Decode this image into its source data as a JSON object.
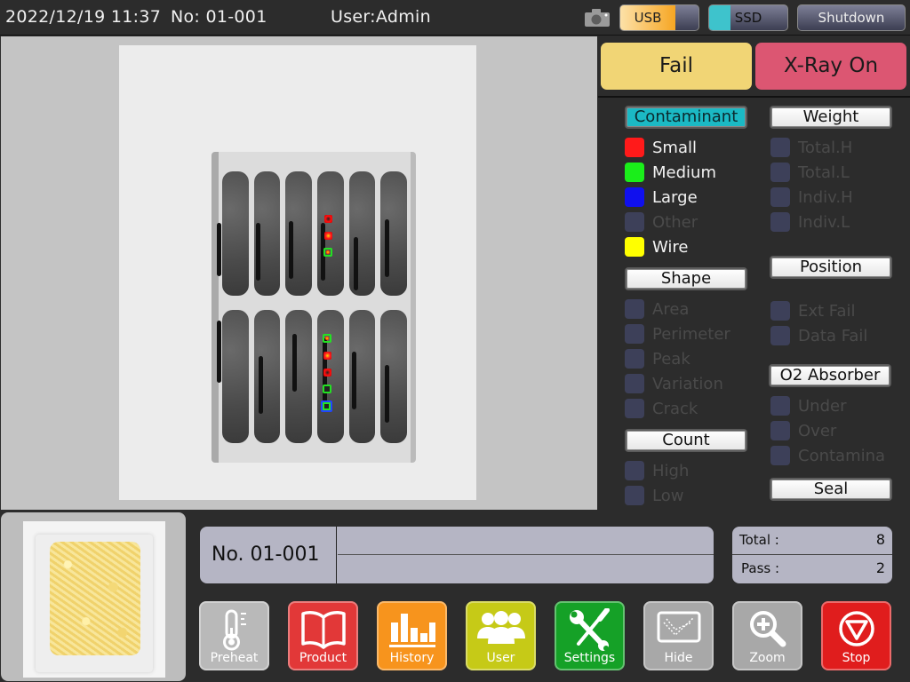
{
  "topbar": {
    "datetime": "2022/12/19  11:37",
    "number": "No: 01-001",
    "user": "User:Admin",
    "camera_icon": "camera-icon",
    "usb_label": "USB",
    "usb_usage_percent": 70,
    "ssd_label": "SSD",
    "ssd_usage_percent": 27,
    "shutdown_label": "Shutdown",
    "colors": {
      "usb": "#f6a623",
      "ssd": "#3ec3cc"
    }
  },
  "status": {
    "result_label": "Fail",
    "result_color": "#f1d575",
    "xray_label": "X-Ray On",
    "xray_color": "#dc5672"
  },
  "categories": {
    "contaminant": {
      "label": "Contaminant",
      "active": true,
      "items": [
        {
          "label": "Small",
          "color": "#ff1a1a",
          "on": true
        },
        {
          "label": "Medium",
          "color": "#1aee1a",
          "on": true
        },
        {
          "label": "Large",
          "color": "#1010ee",
          "on": true
        },
        {
          "label": "Other",
          "color": "#3d4059",
          "on": false
        },
        {
          "label": "Wire",
          "color": "#ffff00",
          "on": true
        }
      ]
    },
    "shape": {
      "label": "Shape",
      "items": [
        {
          "label": "Area",
          "on": false
        },
        {
          "label": "Perimeter",
          "on": false
        },
        {
          "label": "Peak",
          "on": false
        },
        {
          "label": "Variation",
          "on": false
        },
        {
          "label": "Crack",
          "on": false
        }
      ]
    },
    "count": {
      "label": "Count",
      "items": [
        {
          "label": "High",
          "on": false
        },
        {
          "label": "Low",
          "on": false
        }
      ]
    },
    "weight": {
      "label": "Weight",
      "items": [
        {
          "label": "Total.H",
          "on": false
        },
        {
          "label": "Total.L",
          "on": false
        },
        {
          "label": "Indiv.H",
          "on": false
        },
        {
          "label": "Indiv.L",
          "on": false
        }
      ]
    },
    "position": {
      "label": "Position",
      "items": [
        {
          "label": "Ext Fail",
          "on": false
        },
        {
          "label": "Data Fail",
          "on": false
        }
      ]
    },
    "o2": {
      "label": "O2 Absorber",
      "items": [
        {
          "label": "Under",
          "on": false
        },
        {
          "label": "Over",
          "on": false
        },
        {
          "label": "Contamina",
          "on": false
        }
      ]
    },
    "seal": {
      "label": "Seal"
    }
  },
  "info": {
    "product_no": "No. 01-001",
    "line1": "",
    "line2": ""
  },
  "counts": {
    "total_label": "Total :",
    "total_value": "8",
    "pass_label": "Pass :",
    "pass_value": "2"
  },
  "toolbar": [
    {
      "label": "Preheat",
      "icon": "thermometer-icon",
      "color": "#b9b9b9"
    },
    {
      "label": "Product",
      "icon": "book-icon",
      "color": "#e23838"
    },
    {
      "label": "History",
      "icon": "bar-chart-icon",
      "color": "#f7941d"
    },
    {
      "label": "User",
      "icon": "users-icon",
      "color": "#c6ca17"
    },
    {
      "label": "Settings",
      "icon": "wrench-screwdriver-icon",
      "color": "#15a127"
    },
    {
      "label": "Hide",
      "icon": "envelope-icon",
      "color": "#a8a8a8"
    },
    {
      "label": "Zoom",
      "icon": "zoom-in-icon",
      "color": "#a8a8a8"
    },
    {
      "label": "Stop",
      "icon": "stop-triangle-icon",
      "color": "#e01d1d"
    }
  ]
}
